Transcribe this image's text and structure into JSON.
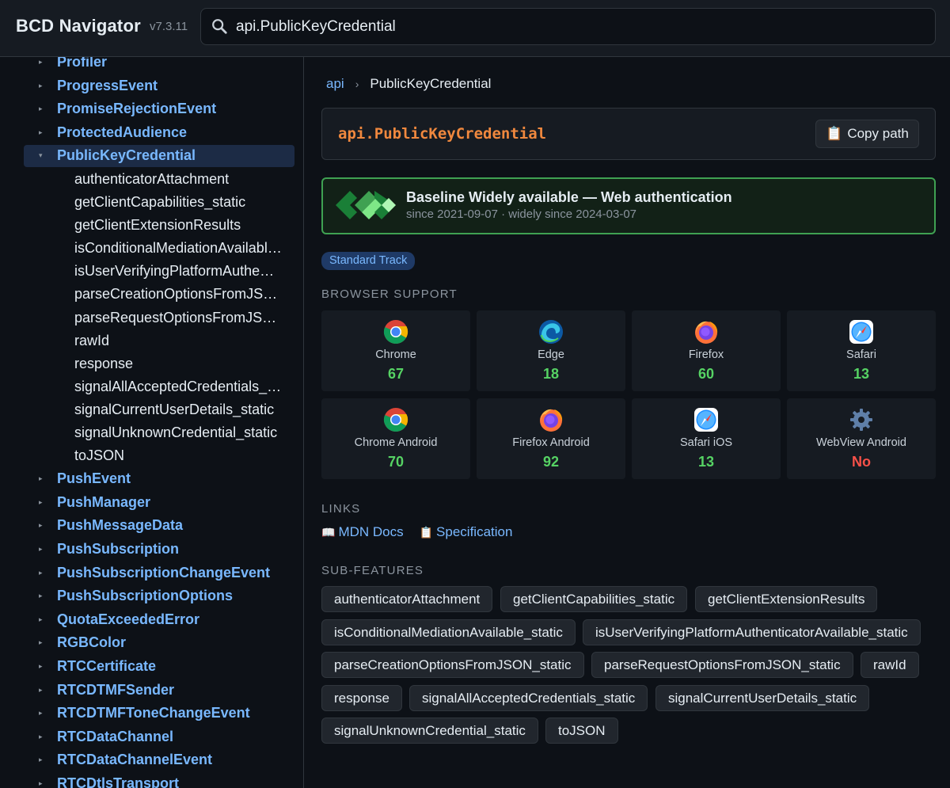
{
  "app": {
    "title": "BCD Navigator",
    "version": "v7.3.11"
  },
  "search": {
    "value": "api.PublicKeyCredential",
    "placeholder": ""
  },
  "sidebar": {
    "items_before": [
      "Profiler",
      "ProgressEvent",
      "PromiseRejectionEvent",
      "ProtectedAudience"
    ],
    "active": "PublicKeyCredential",
    "children": [
      "authenticatorAttachment",
      "getClientCapabilities_static",
      "getClientExtensionResults",
      "isConditionalMediationAvailabl…",
      "isUserVerifyingPlatformAuthe…",
      "parseCreationOptionsFromJS…",
      "parseRequestOptionsFromJS…",
      "rawId",
      "response",
      "signalAllAcceptedCredentials_…",
      "signalCurrentUserDetails_static",
      "signalUnknownCredential_static",
      "toJSON"
    ],
    "items_after": [
      "PushEvent",
      "PushManager",
      "PushMessageData",
      "PushSubscription",
      "PushSubscriptionChangeEvent",
      "PushSubscriptionOptions",
      "QuotaExceededError",
      "RGBColor",
      "RTCCertificate",
      "RTCDTMFSender",
      "RTCDTMFToneChangeEvent",
      "RTCDataChannel",
      "RTCDataChannelEvent",
      "RTCDtlsTransport"
    ]
  },
  "breadcrumb": {
    "root": "api",
    "separator": "›",
    "current": "PublicKeyCredential"
  },
  "feature": {
    "path": "api.PublicKeyCredential",
    "copy_label": "Copy path",
    "copy_icon": "📋"
  },
  "baseline": {
    "title": "Baseline Widely available — Web authentication",
    "subtitle": "since 2021-09-07 · widely since 2024-03-07",
    "color": "#3fa152"
  },
  "track_badge": "Standard Track",
  "sections": {
    "browser_support": "BROWSER SUPPORT",
    "links": "LINKS",
    "sub_features": "SUB-FEATURES"
  },
  "browsers": [
    {
      "name": "Chrome",
      "version": "67",
      "icon": "chrome-icon"
    },
    {
      "name": "Edge",
      "version": "18",
      "icon": "edge-icon"
    },
    {
      "name": "Firefox",
      "version": "60",
      "icon": "firefox-icon"
    },
    {
      "name": "Safari",
      "version": "13",
      "icon": "safari-icon"
    },
    {
      "name": "Chrome Android",
      "version": "70",
      "icon": "chrome-icon"
    },
    {
      "name": "Firefox Android",
      "version": "92",
      "icon": "firefox-icon"
    },
    {
      "name": "Safari iOS",
      "version": "13",
      "icon": "safari-icon"
    },
    {
      "name": "WebView Android",
      "version": "No",
      "icon": "webview-gear-icon"
    }
  ],
  "links": [
    {
      "icon": "📖",
      "label": "MDN Docs"
    },
    {
      "icon": "📋",
      "label": "Specification"
    }
  ],
  "sub_features": [
    "authenticatorAttachment",
    "getClientCapabilities_static",
    "getClientExtensionResults",
    "isConditionalMediationAvailable_static",
    "isUserVerifyingPlatformAuthenticatorAvailable_static",
    "parseCreationOptionsFromJSON_static",
    "parseRequestOptionsFromJSON_static",
    "rawId",
    "response",
    "signalAllAcceptedCredentials_static",
    "signalCurrentUserDetails_static",
    "signalUnknownCredential_static",
    "toJSON"
  ],
  "colors": {
    "supported": "#56d364",
    "unsupported": "#f85149",
    "link": "#79b8ff",
    "accent_path": "#f0883e"
  }
}
